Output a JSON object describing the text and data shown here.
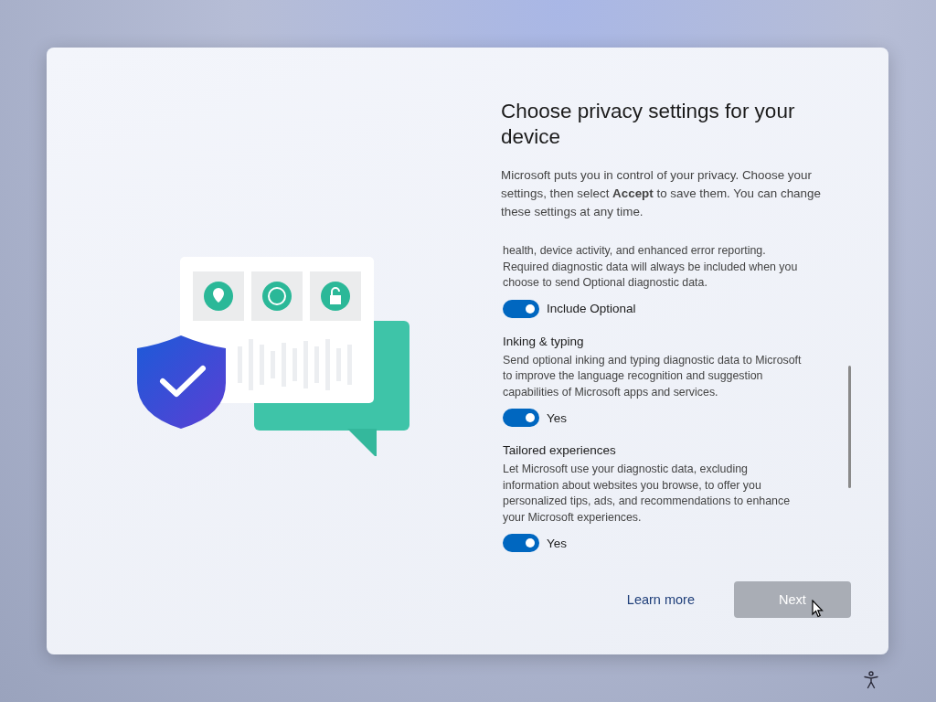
{
  "title": "Choose privacy settings for your device",
  "intro": "Microsoft puts you in control of your privacy. Choose your settings, then select **Accept** to save them. You can change these settings at any time.",
  "settings": [
    {
      "description": "health, device activity, and enhanced error reporting. Required diagnostic data will always be included when you choose to send Optional diagnostic data.",
      "toggle": {
        "on": true,
        "label": "Include Optional"
      }
    },
    {
      "heading": "Inking & typing",
      "description": "Send optional inking and typing diagnostic data to Microsoft to improve the language recognition and suggestion capabilities of Microsoft apps and services.",
      "toggle": {
        "on": true,
        "label": "Yes"
      }
    },
    {
      "heading": "Tailored experiences",
      "description": "Let Microsoft use your diagnostic data, excluding information about websites you browse, to offer you personalized tips, ads, and recommendations to enhance your Microsoft experiences.",
      "toggle": {
        "on": true,
        "label": "Yes"
      }
    }
  ],
  "footer": {
    "link": "Learn more",
    "button": {
      "label": "Next",
      "disabled": true
    }
  }
}
